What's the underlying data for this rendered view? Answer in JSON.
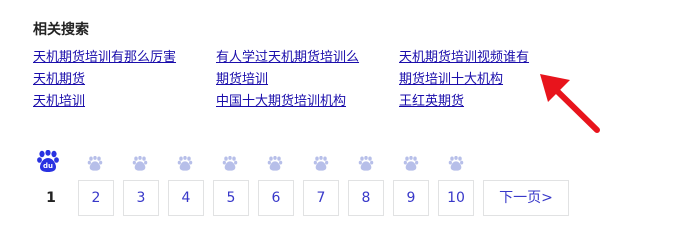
{
  "related": {
    "title": "相关搜索",
    "columns": [
      [
        "天机期货培训有那么厉害",
        "天机期货",
        "天机培训"
      ],
      [
        "有人学过天机期货培训么",
        "期货培训",
        "中国十大期货培训机构"
      ],
      [
        "天机期货培训视频谁有",
        "期货培训十大机构",
        "王红英期货"
      ]
    ]
  },
  "paw": {
    "current_label": "du",
    "current_color": "#2932e1",
    "dim_color": "#7d8bd8"
  },
  "pagination": {
    "current": "1",
    "pages": [
      "2",
      "3",
      "4",
      "5",
      "6",
      "7",
      "8",
      "9",
      "10"
    ],
    "next_label": "下一页>"
  },
  "annotation": {
    "arrow_color": "#e8141c",
    "arrow_icon": "red-arrow-icon"
  }
}
